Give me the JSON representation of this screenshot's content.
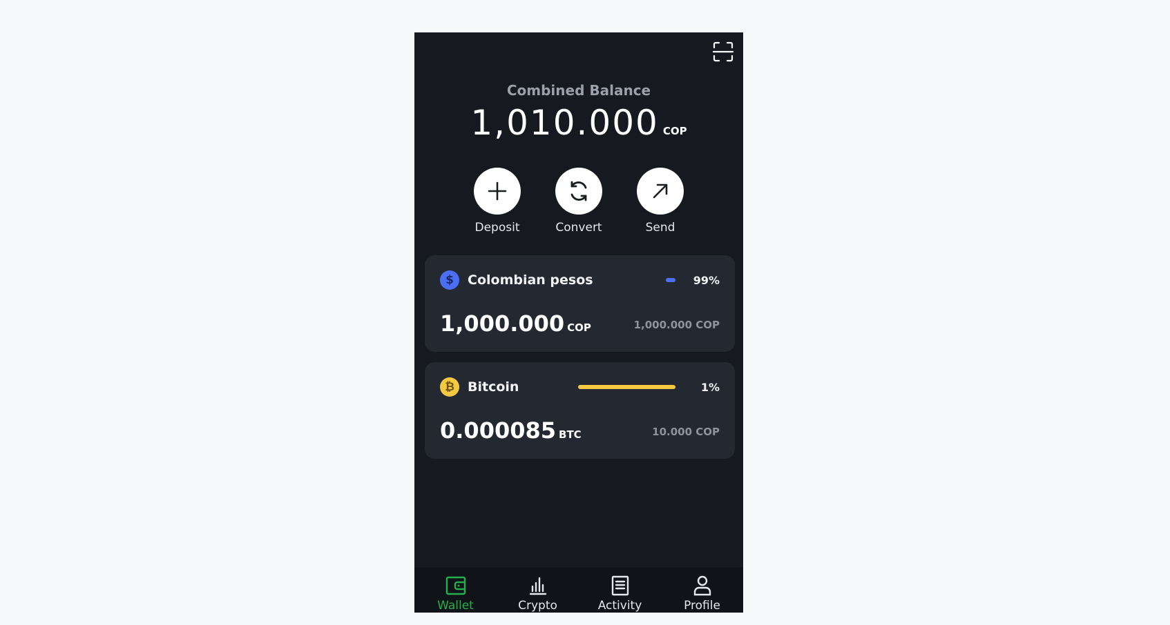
{
  "header": {
    "scan_icon": "scan-icon"
  },
  "balance": {
    "label": "Combined Balance",
    "amount": "1,010.000",
    "currency": "COP"
  },
  "actions": [
    {
      "label": "Deposit",
      "icon": "plus-icon"
    },
    {
      "label": "Convert",
      "icon": "refresh-icon"
    },
    {
      "label": "Send",
      "icon": "arrow-up-right-icon"
    }
  ],
  "assets": [
    {
      "name": "Colombian pesos",
      "icon": "dollar-icon",
      "icon_glyph": "$",
      "color": "#4c6ef5",
      "allocation_percent": 99,
      "allocation_label": "99%",
      "amount": "1,000.000",
      "unit": "COP",
      "value": "1,000.000 COP"
    },
    {
      "name": "Bitcoin",
      "icon": "bitcoin-icon",
      "icon_glyph": "₿",
      "color": "#f5c842",
      "allocation_percent": 1,
      "allocation_label": "1%",
      "amount": "0.000085",
      "unit": "BTC",
      "value": "10.000 COP"
    }
  ],
  "nav": {
    "active_color": "#22b14c",
    "items": [
      {
        "label": "Wallet",
        "icon": "wallet-icon",
        "active": true
      },
      {
        "label": "Crypto",
        "icon": "bar-chart-icon",
        "active": false
      },
      {
        "label": "Activity",
        "icon": "document-icon",
        "active": false
      },
      {
        "label": "Profile",
        "icon": "user-icon",
        "active": false
      }
    ]
  }
}
